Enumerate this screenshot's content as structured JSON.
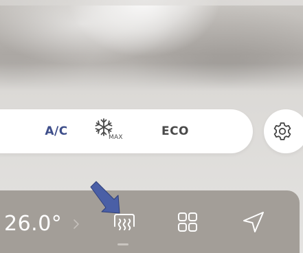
{
  "climate": {
    "ac_label": "A/C",
    "max_label": "MAX",
    "eco_label": "ECO"
  },
  "dock": {
    "temperature": "26.0°"
  },
  "icons": {
    "max_cool": "snowflake-icon",
    "settings": "gear-icon",
    "temperature_more": "chevron-right-icon",
    "rear_defrost": "rear-defrost-icon",
    "apps": "app-grid-icon",
    "navigation": "navigation-arrow-icon",
    "pointer": "pointer-arrow-icon"
  },
  "colors": {
    "ac_active": "#3e4e8a",
    "dock_background": "#a39e98",
    "pill_background": "#ffffff",
    "pointer_arrow": "#4a5fa6"
  }
}
